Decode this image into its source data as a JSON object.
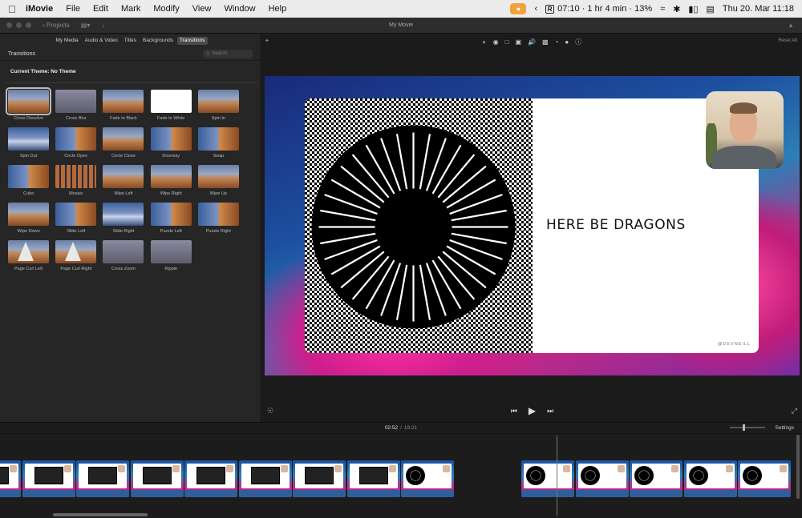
{
  "menubar": {
    "apple": "",
    "items": [
      "iMovie",
      "File",
      "Edit",
      "Mark",
      "Modify",
      "View",
      "Window",
      "Help"
    ],
    "status_timer": "07:10 · 1 hr 4 min · 13%",
    "timer_icon_letter": "R",
    "datetime": "Thu 20. Mar  11:18"
  },
  "titlebar": {
    "projects": "Projects",
    "title": "My Movie"
  },
  "browser": {
    "tabs": [
      "My Media",
      "Audio & Video",
      "Titles",
      "Backgrounds",
      "Transitions"
    ],
    "active_tab": "Transitions",
    "section_title": "Transitions",
    "search_placeholder": "Search",
    "theme": "Current Theme: No Theme",
    "transitions": [
      {
        "label": "Cross Dissolve",
        "style": "land",
        "selected": true
      },
      {
        "label": "Cross Blur",
        "style": "grey"
      },
      {
        "label": "Fade to Black",
        "style": "land"
      },
      {
        "label": "Fade to White",
        "style": "white"
      },
      {
        "label": "Spin In",
        "style": "land"
      },
      {
        "label": "Spin Out",
        "style": "land2"
      },
      {
        "label": "Circle Open",
        "style": "mix"
      },
      {
        "label": "Circle Close",
        "style": "land"
      },
      {
        "label": "Doorway",
        "style": "mix"
      },
      {
        "label": "Swap",
        "style": "mix"
      },
      {
        "label": "Cube",
        "style": "mix"
      },
      {
        "label": "Mosaic",
        "style": "mosaic"
      },
      {
        "label": "Wipe Left",
        "style": "land"
      },
      {
        "label": "Wipe Right",
        "style": "land"
      },
      {
        "label": "Wipe Up",
        "style": "land"
      },
      {
        "label": "Wipe Down",
        "style": "land"
      },
      {
        "label": "Slide Left",
        "style": "mix"
      },
      {
        "label": "Slide Right",
        "style": "land2"
      },
      {
        "label": "Puzzle Left",
        "style": "mix"
      },
      {
        "label": "Puzzle Right",
        "style": "mix"
      },
      {
        "label": "Page Curl Left",
        "style": "land curl"
      },
      {
        "label": "Page Curl Right",
        "style": "land curl"
      },
      {
        "label": "Cross Zoom",
        "style": "grey"
      },
      {
        "label": "Ripple",
        "style": "grey"
      }
    ]
  },
  "viewer": {
    "reset_all": "Reset All",
    "slide_title": "HERE BE DRAGONS",
    "slide_credit": "@DEVNEILL"
  },
  "timeline": {
    "current_time": "02:52",
    "separator": "/",
    "total_time": "19:21",
    "settings": "Settings"
  }
}
